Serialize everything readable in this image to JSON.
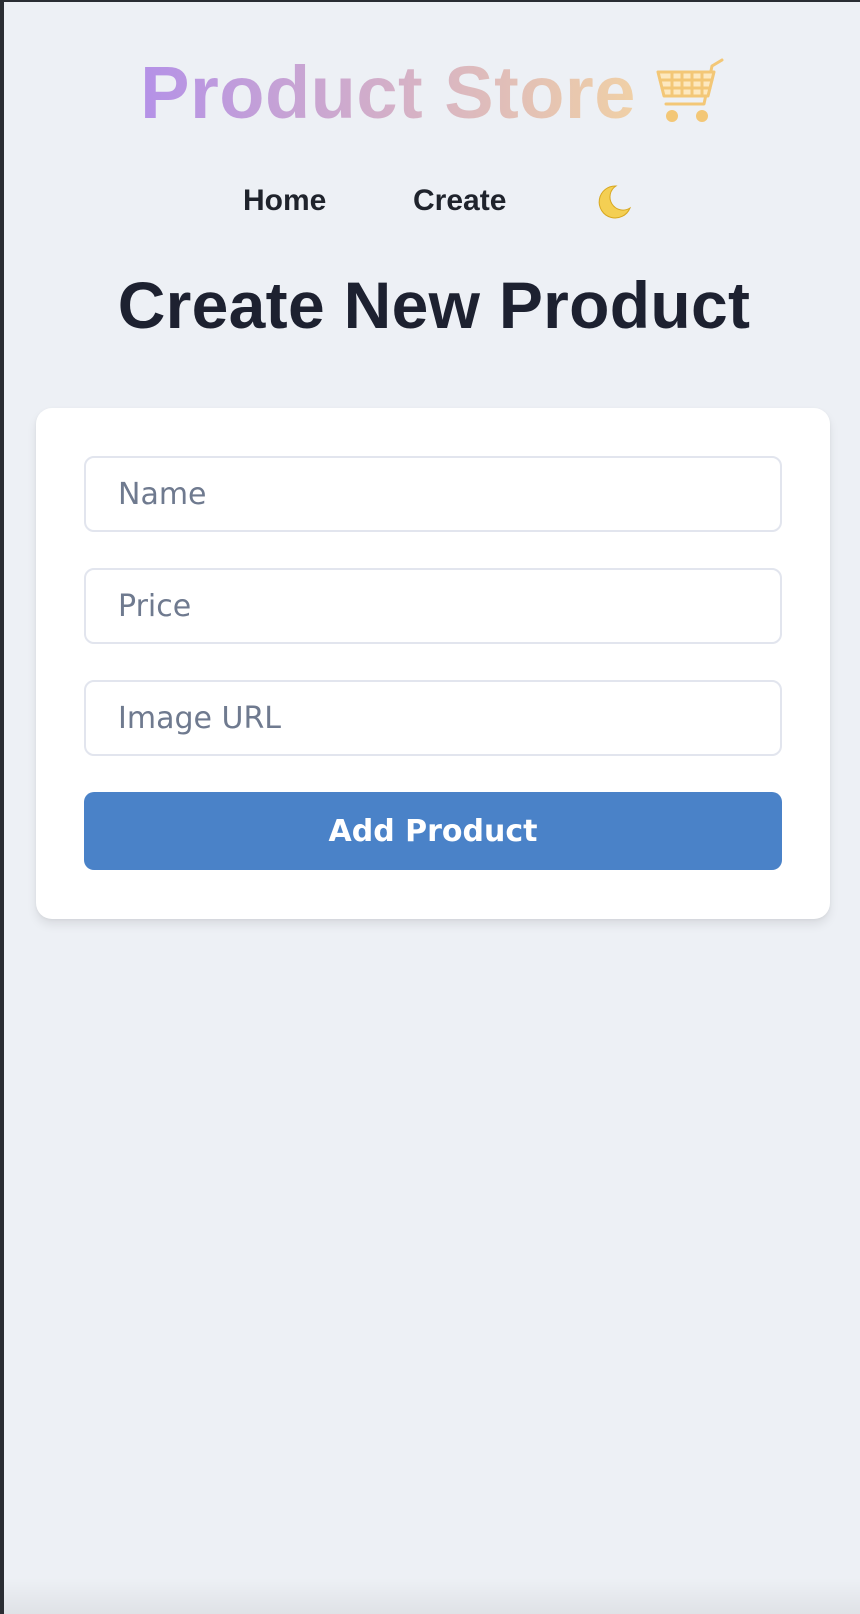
{
  "header": {
    "brand": "Product Store",
    "brand_icon": "shopping-cart-icon",
    "brand_gradient": [
      "#b491e7",
      "#d6b2c5",
      "#f0d0a6"
    ]
  },
  "nav": {
    "home_label": "Home",
    "create_label": "Create",
    "theme_icon": "crescent-moon-icon"
  },
  "main": {
    "title": "Create New Product"
  },
  "form": {
    "name_placeholder": "Name",
    "name_value": "",
    "price_placeholder": "Price",
    "price_value": "",
    "image_placeholder": "Image URL",
    "image_value": "",
    "submit_label": "Add Product",
    "submit_color": "#4a82c8"
  },
  "colors": {
    "background": "#edf0f5",
    "card": "#ffffff",
    "text": "#1f232c",
    "placeholder": "#6f7a8f"
  }
}
